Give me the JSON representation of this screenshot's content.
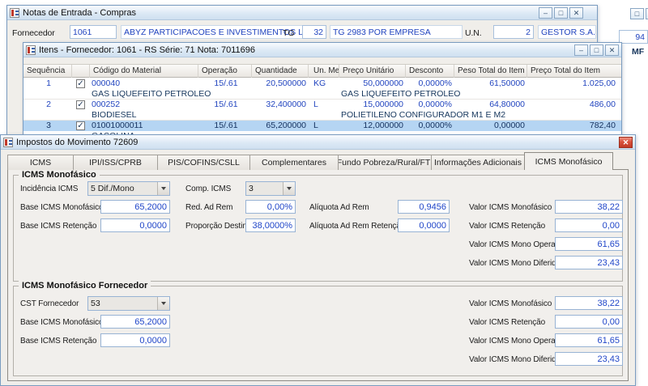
{
  "colors": {
    "accent_text": "#2144bf",
    "selection": "#b5d5f3",
    "close_button": "#c23a26"
  },
  "back_window": {
    "title": "Notas de Entrada - Compras",
    "fornecedor_label": "Fornecedor",
    "fornecedor_code": "1061",
    "fornecedor_name": "ABYZ PARTICIPACOES E INVESTIMENTOS LTDA",
    "tg_label": "TG",
    "tg_code": "32",
    "tg_desc": "TG 2983 POR EMPRESA",
    "un_label": "U.N.",
    "un_code": "2",
    "un_name": "GESTOR S.A."
  },
  "items_window": {
    "title": "Itens - Fornecedor: 1061 - RS Série: 71   Nota: 7011696",
    "columns": {
      "seq": "Sequência",
      "codigo": "Código do Material",
      "operacao": "Operação",
      "quantidade": "Quantidade",
      "un_med": "Un. Med.",
      "preco_unitario": "Preço Unitário",
      "desconto": "Desconto",
      "peso_total": "Peso Total do Item",
      "preco_total": "Preço Total do Item"
    },
    "rows": [
      {
        "seq": "1",
        "checked": true,
        "codigo": "000040",
        "operacao": "15/.61",
        "quantidade": "20,500000",
        "un": "KG",
        "preco_unitario": "50,000000",
        "desconto": "0,0000%",
        "peso_total": "61,50000",
        "preco_total": "1.025,00",
        "descricao": "GAS LIQUEFEITO PETROLEO",
        "descricao2": "GAS LIQUEFEITO PETROLEO"
      },
      {
        "seq": "2",
        "checked": true,
        "codigo": "000252",
        "operacao": "15/.61",
        "quantidade": "32,400000",
        "un": "L",
        "preco_unitario": "15,000000",
        "desconto": "0,0000%",
        "peso_total": "64,80000",
        "preco_total": "486,00",
        "descricao": "BIODIESEL",
        "descricao2": "POLIETILENO CONFIGURADOR M1 E M2"
      },
      {
        "seq": "3",
        "checked": true,
        "codigo": "01001000011",
        "operacao": "15/.61",
        "quantidade": "65,200000",
        "un": "L",
        "preco_unitario": "12,000000",
        "desconto": "0,0000%",
        "peso_total": "0,00000",
        "preco_total": "782,40",
        "descricao": "GASOLINA",
        "descricao2": ""
      }
    ],
    "selected_row": "3"
  },
  "tax_window": {
    "title": "Impostos do Movimento 72609",
    "tabs": [
      "ICMS",
      "IPI/ISS/CPRB",
      "PIS/COFINS/CSLL",
      "Complementares",
      "Fundo Pobreza/Rural/FTI",
      "Informações Adicionais",
      "ICMS Monofásico"
    ],
    "active_tab": "ICMS Monofásico",
    "group1": {
      "title": "ICMS Monofásico",
      "incidencia_label": "Incidência ICMS",
      "incidencia_value": "5 Dif./Mono",
      "comp_icms_label": "Comp. ICMS",
      "comp_icms_value": "3",
      "base_mono_label": "Base ICMS Monofásico",
      "base_mono_value": "65,2000",
      "red_ad_rem_label": "Red. Ad Rem",
      "red_ad_rem_value": "0,00%",
      "aliquota_label": "Alíquota Ad Rem",
      "aliquota_value": "0,9456",
      "valor_mono_label": "Valor ICMS Monofásico",
      "valor_mono_value": "38,22",
      "base_ret_label": "Base ICMS Retenção",
      "base_ret_value": "0,0000",
      "proporcao_label": "Proporção Destino",
      "proporcao_value": "38,0000%",
      "aliquota_ret_label": "Alíquota Ad Rem Retenção",
      "aliquota_ret_value": "0,0000",
      "valor_ret_label": "Valor ICMS Retenção",
      "valor_ret_value": "0,00",
      "valor_oper_label": "Valor ICMS Mono Operação",
      "valor_oper_value": "61,65",
      "valor_dif_label": "Valor ICMS Mono Diferido",
      "valor_dif_value": "23,43"
    },
    "group2": {
      "title": "ICMS Monofásico Fornecedor",
      "cst_label": "CST Fornecedor",
      "cst_value": "53",
      "base_mono_label": "Base ICMS Monofásico",
      "base_mono_value": "65,2000",
      "base_ret_label": "Base ICMS Retenção",
      "base_ret_value": "0,0000",
      "valor_mono_label": "Valor ICMS Monofásico",
      "valor_mono_value": "38,22",
      "valor_ret_label": "Valor ICMS Retenção",
      "valor_ret_value": "0,00",
      "valor_oper_label": "Valor ICMS Mono Operação",
      "valor_oper_value": "61,65",
      "valor_dif_label": "Valor ICMS Mono Diferido",
      "valor_dif_value": "23,43"
    }
  },
  "fragments": {
    "right_number": "94",
    "right_text": "MF"
  }
}
